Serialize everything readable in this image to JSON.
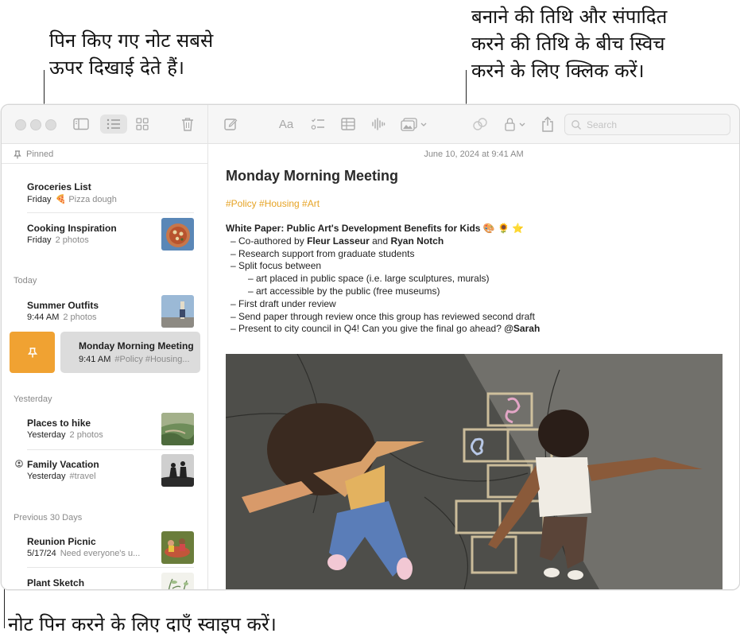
{
  "callouts": {
    "pinned": [
      "पिन किए गए नोट सबसे",
      "ऊपर दिखाई देते हैं।"
    ],
    "date_switch": [
      "बनाने की तिथि और संपादित",
      "करने की तिथि के बीच स्विच",
      "करने के लिए क्लिक करें।"
    ],
    "swipe": "नोट पिन करने के लिए दाएँ स्वाइप करें।"
  },
  "toolbar": {
    "format_label": "Aa",
    "search_placeholder": "Search",
    "icons": [
      "sidebar-icon",
      "list-view-icon",
      "gallery-view-icon",
      "trash-icon",
      "compose-icon",
      "format-icon",
      "checklist-icon",
      "table-icon",
      "audio-icon",
      "media-icon",
      "collaborate-icon",
      "lock-icon",
      "share-icon",
      "search-icon"
    ]
  },
  "sidebar": {
    "pinned_label": "Pinned",
    "sections": {
      "today": "Today",
      "yesterday": "Yesterday",
      "previous30": "Previous 30 Days"
    },
    "notes": [
      {
        "title": "Groceries List",
        "date": "Friday",
        "sub": "🍕 Pizza dough"
      },
      {
        "title": "Cooking Inspiration",
        "date": "Friday",
        "sub": "2 photos"
      },
      {
        "title": "Summer Outfits",
        "date": "9:44 AM",
        "sub": "2 photos"
      },
      {
        "title": "Monday Morning Meeting",
        "date": "9:41 AM",
        "sub": "#Policy #Housing..."
      },
      {
        "title": "Places to hike",
        "date": "Yesterday",
        "sub": "2 photos"
      },
      {
        "title": "Family Vacation",
        "date": "Yesterday",
        "sub": "#travel"
      },
      {
        "title": "Reunion Picnic",
        "date": "5/17/24",
        "sub": "Need everyone's u..."
      },
      {
        "title": "Plant Sketch",
        "date": "",
        "sub": ""
      }
    ]
  },
  "editor": {
    "date": "June 10, 2024 at 9:41 AM",
    "title": "Monday Morning Meeting",
    "tags": "#Policy #Housing #Art",
    "heading": "White Paper: Public Art's Development Benefits for Kids 🎨 🌻 ⭐",
    "bullet_coauthor_prefix": "–  Co-authored by ",
    "coauthor1": "Fleur Lasseur",
    "and": " and ",
    "coauthor2": "Ryan Notch",
    "b_research": "–  Research support from graduate students",
    "b_split": "–  Split focus between",
    "b_sub1": "–  art placed in public space (i.e. large sculptures, murals)",
    "b_sub2": "–  art accessible by the public (free museums)",
    "b_draft": "–  First draft under review",
    "b_send": "–  Send paper through review once this group has reviewed second draft",
    "b_present_prefix": "–  Present to city council in Q4! Can you give the final go ahead? ",
    "mention": "@Sarah"
  },
  "colors": {
    "accent": "#f0a232",
    "tag": "#e6a324",
    "selected_row": "#dcdcdc"
  }
}
